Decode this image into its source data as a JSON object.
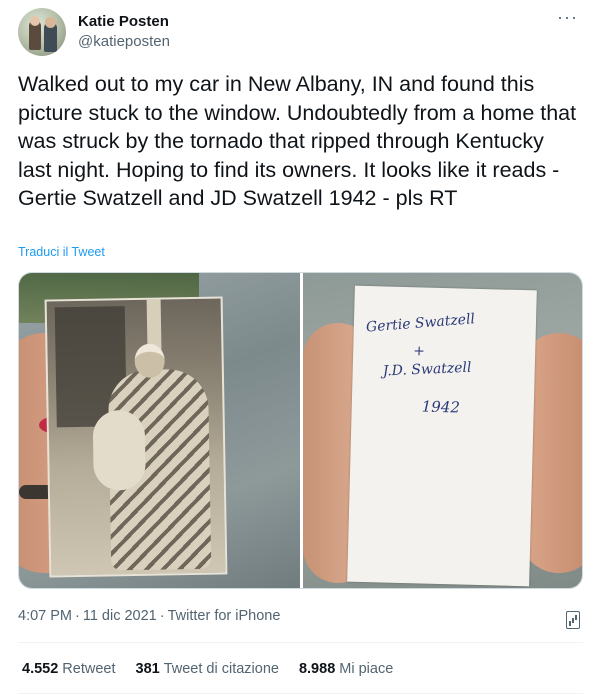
{
  "user": {
    "display_name": "Katie Posten",
    "username": "@katieposten"
  },
  "more_label": "···",
  "tweet": {
    "text": "Walked out to my car in New Albany, IN and found this picture stuck to the window. Undoubtedly from a home that was struck by the tornado that ripped through Kentucky last night. Hoping to find its owners. It looks like it reads - Gertie Swatzell and JD Swatzell 1942 - pls RT",
    "translate_label": "Traduci il Tweet"
  },
  "media": {
    "back_writing": {
      "line1": "Gertie Swatzell",
      "line2": "+",
      "line3": "J.D. Swatzell",
      "line4": "1942"
    }
  },
  "meta": {
    "time": "4:07 PM",
    "date": "11 dic 2021",
    "source": "Twitter for iPhone"
  },
  "stats": {
    "retweets_count": "4.552",
    "retweets_label": "Retweet",
    "quotes_count": "381",
    "quotes_label": "Tweet di citazione",
    "likes_count": "8.988",
    "likes_label": "Mi piace"
  },
  "icons": {
    "more": "more-horizontal-icon",
    "analytics": "analytics-icon"
  },
  "colors": {
    "link": "#1d9bf0",
    "secondary_text": "#536471",
    "primary_text": "#0f1419"
  }
}
